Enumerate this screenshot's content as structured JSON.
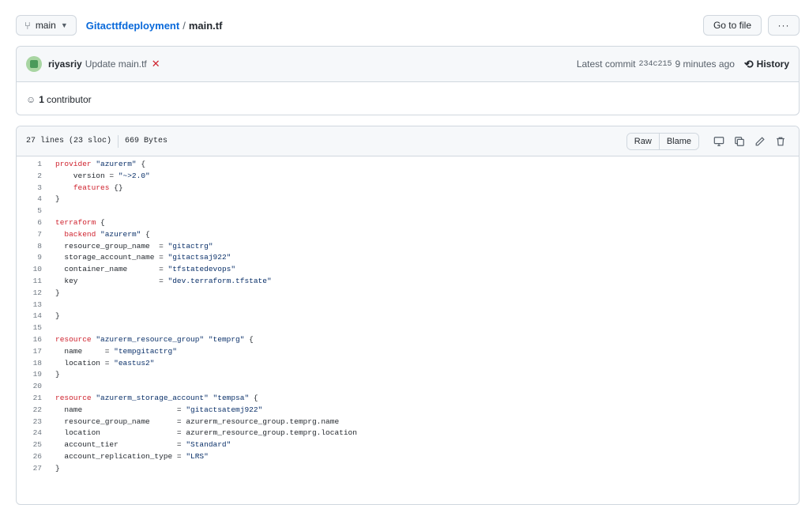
{
  "nav": {
    "branch_label": "main",
    "repo_link": "Gitacttfdeployment",
    "path_separator": "/",
    "file_name": "main.tf",
    "go_to_file_label": "Go to file",
    "more_label": "···"
  },
  "commit": {
    "author": "riyasriy",
    "message": "Update main.tf",
    "status_icon": "✕",
    "latest_label": "Latest commit",
    "sha": "234c215",
    "time_ago": "9 minutes ago",
    "history_label": "History"
  },
  "contributors": {
    "count": "1",
    "label": "contributor"
  },
  "file": {
    "lines_info": "27 lines (23 sloc)",
    "size": "669 Bytes",
    "raw_label": "Raw",
    "blame_label": "Blame"
  },
  "code_lines": [
    {
      "n": "1",
      "t": "provider \"azurerm\" {"
    },
    {
      "n": "2",
      "t": "    version = \"~>2.0\""
    },
    {
      "n": "3",
      "t": "    features {}"
    },
    {
      "n": "4",
      "t": "}"
    },
    {
      "n": "5",
      "t": ""
    },
    {
      "n": "6",
      "t": "terraform {"
    },
    {
      "n": "7",
      "t": "  backend \"azurerm\" {"
    },
    {
      "n": "8",
      "t": "  resource_group_name  = \"gitactrg\""
    },
    {
      "n": "9",
      "t": "  storage_account_name = \"gitactsaj922\""
    },
    {
      "n": "10",
      "t": "  container_name       = \"tfstatedevops\""
    },
    {
      "n": "11",
      "t": "  key                  = \"dev.terraform.tfstate\""
    },
    {
      "n": "12",
      "t": "}"
    },
    {
      "n": "13",
      "t": ""
    },
    {
      "n": "14",
      "t": "}"
    },
    {
      "n": "15",
      "t": ""
    },
    {
      "n": "16",
      "t": "resource \"azurerm_resource_group\" \"temprg\" {"
    },
    {
      "n": "17",
      "t": "  name     = \"tempgitactrg\""
    },
    {
      "n": "18",
      "t": "  location = \"eastus2\""
    },
    {
      "n": "19",
      "t": "}"
    },
    {
      "n": "20",
      "t": ""
    },
    {
      "n": "21",
      "t": "resource \"azurerm_storage_account\" \"tempsa\" {"
    },
    {
      "n": "22",
      "t": "  name                     = \"gitactsatemj922\""
    },
    {
      "n": "23",
      "t": "  resource_group_name      = azurerm_resource_group.temprg.name"
    },
    {
      "n": "24",
      "t": "  location                 = azurerm_resource_group.temprg.location"
    },
    {
      "n": "25",
      "t": "  account_tier             = \"Standard\""
    },
    {
      "n": "26",
      "t": "  account_replication_type = \"LRS\""
    },
    {
      "n": "27",
      "t": "}"
    }
  ],
  "colors": {
    "link": "#0969da",
    "keyword": "#cf222e",
    "string": "#0a3069",
    "fail": "#cf222e",
    "border": "#d0d7de"
  }
}
